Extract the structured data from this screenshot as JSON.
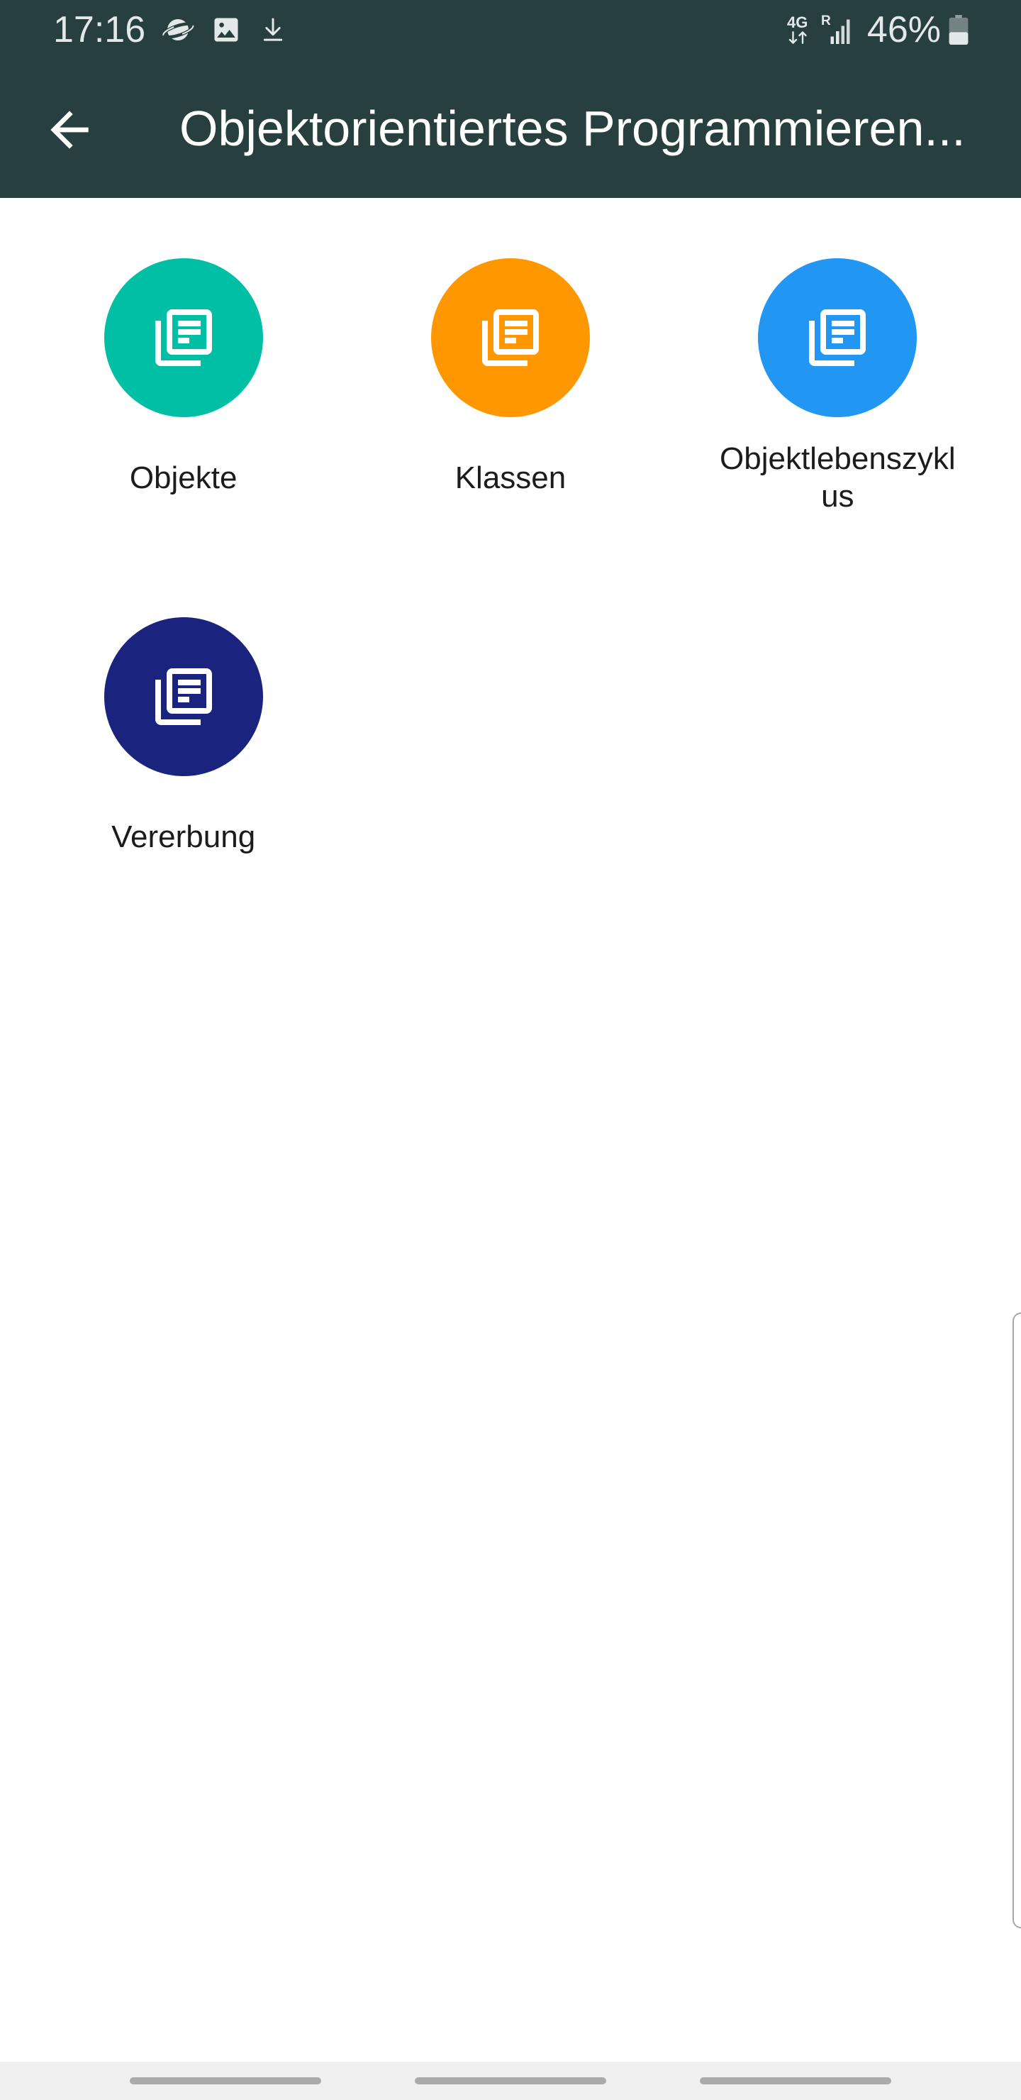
{
  "colors": {
    "header_background": "#283f3f"
  },
  "status_bar": {
    "time": "17:16",
    "notification_icons": [
      "planet-icon",
      "image-icon",
      "download-icon"
    ],
    "network_type": "4G",
    "roaming_indicator": "R",
    "battery_percent": "46%",
    "battery_level": 0.46
  },
  "toolbar": {
    "back_icon": "arrow-back-icon",
    "title": "Objektorientiertes Programmieren..."
  },
  "topics": [
    {
      "label": "Objekte",
      "color": "#00bfa5",
      "icon": "library-books-icon"
    },
    {
      "label": "Klassen",
      "color": "#ff9800",
      "icon": "library-books-icon"
    },
    {
      "label": "Objektlebenszyklus",
      "color": "#2196f3",
      "icon": "library-books-icon"
    },
    {
      "label": "Vererbung",
      "color": "#1a237e",
      "icon": "library-books-icon"
    }
  ]
}
